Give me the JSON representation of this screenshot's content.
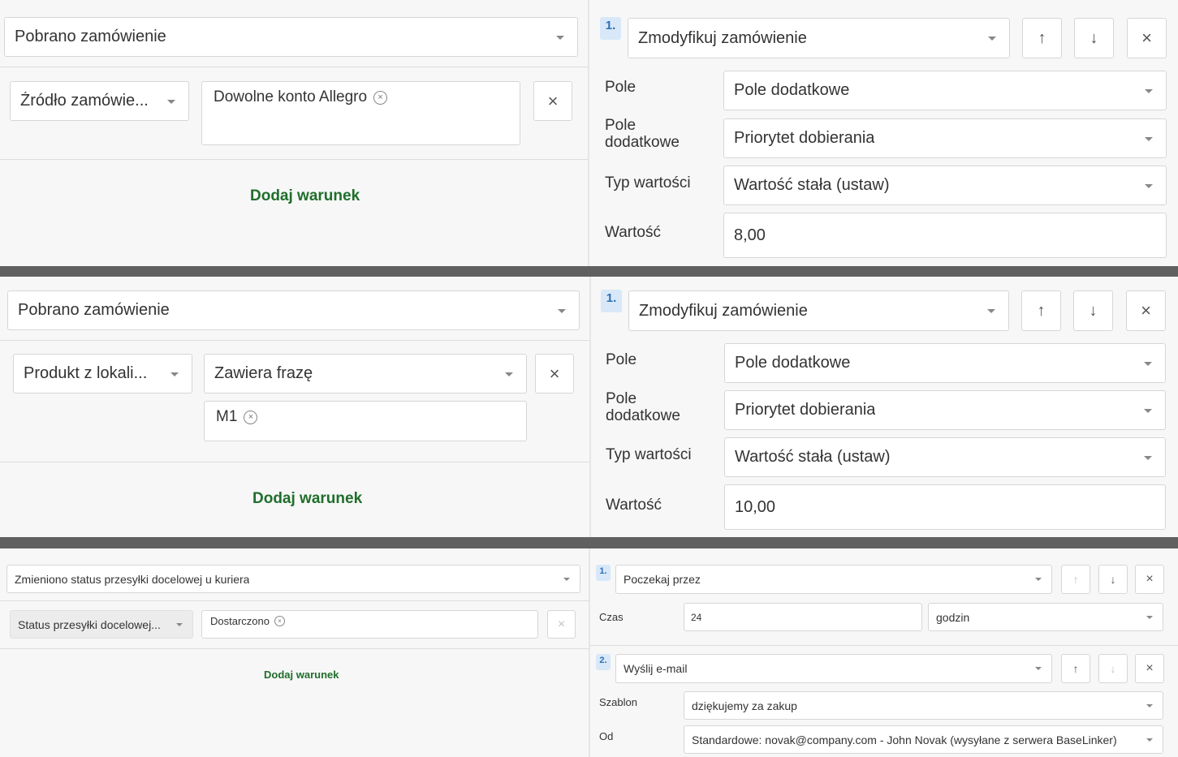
{
  "panel1": {
    "trigger": "Pobrano zamówienie",
    "condition": {
      "field": "Źródło zamówie...",
      "value_tag": "Dowolne konto Allegro",
      "remove_label": "×"
    },
    "add_condition": "Dodaj warunek",
    "action": {
      "number": "1.",
      "type": "Zmodyfikuj zamówienie",
      "up": "↑",
      "down": "↓",
      "close": "×",
      "rows": [
        {
          "label": "Pole",
          "value": "Pole dodatkowe"
        },
        {
          "label": "Pole dodatkowe",
          "value": "Priorytet dobierania"
        },
        {
          "label": "Typ wartości",
          "value": "Wartość stała (ustaw)"
        },
        {
          "label": "Wartość",
          "value": "8,00"
        }
      ]
    }
  },
  "panel2": {
    "trigger": "Pobrano zamówienie",
    "condition": {
      "field": "Produkt z lokali...",
      "operator": "Zawiera frazę",
      "value_tag": "M1",
      "remove_label": "×"
    },
    "add_condition": "Dodaj warunek",
    "action": {
      "number": "1.",
      "type": "Zmodyfikuj zamówienie",
      "up": "↑",
      "down": "↓",
      "close": "×",
      "rows": [
        {
          "label": "Pole",
          "value": "Pole dodatkowe"
        },
        {
          "label": "Pole dodatkowe",
          "value": "Priorytet dobierania"
        },
        {
          "label": "Typ wartości",
          "value": "Wartość stała (ustaw)"
        },
        {
          "label": "Wartość",
          "value": "10,00"
        }
      ]
    }
  },
  "panel3": {
    "trigger": "Zmieniono status przesyłki docelowej u kuriera",
    "condition": {
      "field": "Status przesyłki docelowej...",
      "value_tag": "Dostarczono",
      "remove_label": "×"
    },
    "add_condition": "Dodaj warunek",
    "action1": {
      "number": "1.",
      "type": "Poczekaj przez",
      "up": "↑",
      "down": "↓",
      "close": "×",
      "time_label": "Czas",
      "time_value": "24",
      "unit": "godzin"
    },
    "action2": {
      "number": "2.",
      "type": "Wyślij e-mail",
      "up": "↑",
      "down": "↓",
      "close": "×",
      "template_label": "Szablon",
      "template_value": "dziękujemy za zakup",
      "from_label": "Od",
      "from_value": "Standardowe: novak@company.com - John Novak (wysyłane z serwera BaseLinker)"
    }
  },
  "colors": {
    "link_green": "#1f6e2b",
    "badge_bg": "#d8e8f8",
    "badge_text": "#2f6fb5",
    "separator": "#606060"
  }
}
